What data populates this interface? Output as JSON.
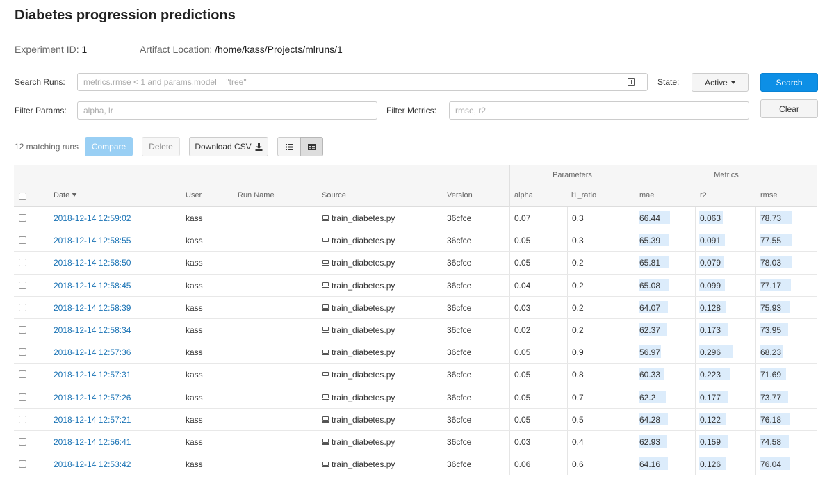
{
  "experiment": {
    "title": "Diabetes progression predictions",
    "id_label": "Experiment ID:",
    "id_value": "1",
    "artifact_label": "Artifact Location:",
    "artifact_value": "/home/kass/Projects/mlruns/1"
  },
  "search": {
    "runs_label": "Search Runs:",
    "runs_placeholder": "metrics.rmse < 1 and params.model = \"tree\"",
    "state_label": "State:",
    "state_value": "Active",
    "search_button": "Search",
    "clear_button": "Clear",
    "params_label": "Filter Params:",
    "params_placeholder": "alpha, lr",
    "metrics_label": "Filter Metrics:",
    "metrics_placeholder": "rmse, r2"
  },
  "toolbar": {
    "match_count": "12 matching runs",
    "compare_button": "Compare",
    "delete_button": "Delete",
    "download_button": "Download CSV",
    "list_view_icon": "list-icon",
    "table_view_icon": "table-icon"
  },
  "table": {
    "group_parameters": "Parameters",
    "group_metrics": "Metrics",
    "col_date": "Date",
    "col_user": "User",
    "col_run_name": "Run Name",
    "col_source": "Source",
    "col_version": "Version",
    "col_alpha": "alpha",
    "col_l1_ratio": "l1_ratio",
    "col_mae": "mae",
    "col_r2": "r2",
    "col_rmse": "rmse",
    "source_icon": "laptop-icon",
    "bar_color": "#dcecfb",
    "link_color": "#1a73b5",
    "rows": [
      {
        "date": "2018-12-14 12:59:02",
        "user": "kass",
        "run_name": "",
        "source": "train_diabetes.py",
        "version": "36cfce",
        "alpha": "0.07",
        "l1_ratio": "0.3",
        "mae": "66.44",
        "r2": "0.063",
        "rmse": "78.73"
      },
      {
        "date": "2018-12-14 12:58:55",
        "user": "kass",
        "run_name": "",
        "source": "train_diabetes.py",
        "version": "36cfce",
        "alpha": "0.05",
        "l1_ratio": "0.3",
        "mae": "65.39",
        "r2": "0.091",
        "rmse": "77.55"
      },
      {
        "date": "2018-12-14 12:58:50",
        "user": "kass",
        "run_name": "",
        "source": "train_diabetes.py",
        "version": "36cfce",
        "alpha": "0.05",
        "l1_ratio": "0.2",
        "mae": "65.81",
        "r2": "0.079",
        "rmse": "78.03"
      },
      {
        "date": "2018-12-14 12:58:45",
        "user": "kass",
        "run_name": "",
        "source": "train_diabetes.py",
        "version": "36cfce",
        "alpha": "0.04",
        "l1_ratio": "0.2",
        "mae": "65.08",
        "r2": "0.099",
        "rmse": "77.17"
      },
      {
        "date": "2018-12-14 12:58:39",
        "user": "kass",
        "run_name": "",
        "source": "train_diabetes.py",
        "version": "36cfce",
        "alpha": "0.03",
        "l1_ratio": "0.2",
        "mae": "64.07",
        "r2": "0.128",
        "rmse": "75.93"
      },
      {
        "date": "2018-12-14 12:58:34",
        "user": "kass",
        "run_name": "",
        "source": "train_diabetes.py",
        "version": "36cfce",
        "alpha": "0.02",
        "l1_ratio": "0.2",
        "mae": "62.37",
        "r2": "0.173",
        "rmse": "73.95"
      },
      {
        "date": "2018-12-14 12:57:36",
        "user": "kass",
        "run_name": "",
        "source": "train_diabetes.py",
        "version": "36cfce",
        "alpha": "0.05",
        "l1_ratio": "0.9",
        "mae": "56.97",
        "r2": "0.296",
        "rmse": "68.23"
      },
      {
        "date": "2018-12-14 12:57:31",
        "user": "kass",
        "run_name": "",
        "source": "train_diabetes.py",
        "version": "36cfce",
        "alpha": "0.05",
        "l1_ratio": "0.8",
        "mae": "60.33",
        "r2": "0.223",
        "rmse": "71.69"
      },
      {
        "date": "2018-12-14 12:57:26",
        "user": "kass",
        "run_name": "",
        "source": "train_diabetes.py",
        "version": "36cfce",
        "alpha": "0.05",
        "l1_ratio": "0.7",
        "mae": "62.2",
        "r2": "0.177",
        "rmse": "73.77"
      },
      {
        "date": "2018-12-14 12:57:21",
        "user": "kass",
        "run_name": "",
        "source": "train_diabetes.py",
        "version": "36cfce",
        "alpha": "0.05",
        "l1_ratio": "0.5",
        "mae": "64.28",
        "r2": "0.122",
        "rmse": "76.18"
      },
      {
        "date": "2018-12-14 12:56:41",
        "user": "kass",
        "run_name": "",
        "source": "train_diabetes.py",
        "version": "36cfce",
        "alpha": "0.03",
        "l1_ratio": "0.4",
        "mae": "62.93",
        "r2": "0.159",
        "rmse": "74.58"
      },
      {
        "date": "2018-12-14 12:53:42",
        "user": "kass",
        "run_name": "",
        "source": "train_diabetes.py",
        "version": "36cfce",
        "alpha": "0.06",
        "l1_ratio": "0.6",
        "mae": "64.16",
        "r2": "0.126",
        "rmse": "76.04"
      }
    ]
  }
}
